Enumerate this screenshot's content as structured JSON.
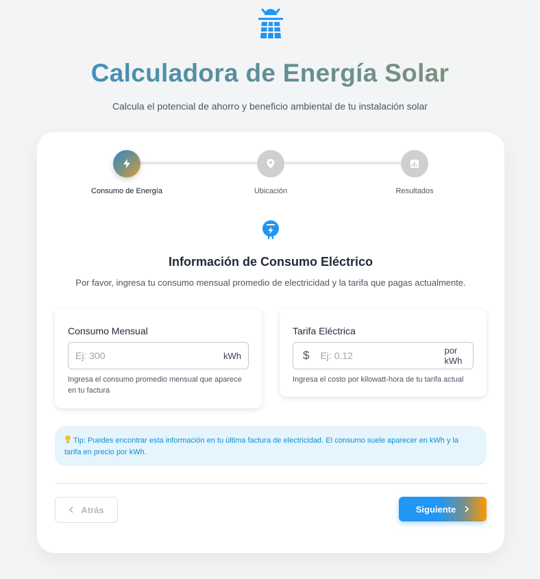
{
  "header": {
    "logo_icon": "solar-panel-icon",
    "title": "Calculadora de Energía Solar",
    "subtitle": "Calcula el potencial de ahorro y beneficio ambiental de tu instalación solar"
  },
  "steps": [
    {
      "label": "Consumo de Energía",
      "icon": "bolt-icon",
      "state": "active"
    },
    {
      "label": "Ubicación",
      "icon": "location-pin-icon",
      "state": "inactive"
    },
    {
      "label": "Resultados",
      "icon": "bar-chart-icon",
      "state": "inactive"
    }
  ],
  "section": {
    "icon": "electric-meter-icon",
    "title": "Información de Consumo Eléctrico",
    "description": "Por favor, ingresa tu consumo mensual promedio de electricidad y la tarifa que pagas actualmente."
  },
  "consumo": {
    "label": "Consumo Mensual",
    "placeholder": "Ej: 300",
    "value": "",
    "unit": "kWh",
    "helper_line1": "Ingresa el consumo promedio mensual que aparece",
    "helper_line2": "en tu factura"
  },
  "tarifa": {
    "label": "Tarifa Eléctrica",
    "prefix": "$",
    "placeholder": "Ej: 0.12",
    "value": "",
    "unit": "por kWh",
    "helper": "Ingresa el costo por kilowatt-hora de tu tarifa actual"
  },
  "tip": {
    "icon": "lightbulb-icon",
    "line1": "Tip: Puedes encontrar esta información en tu última factura de electricidad. El consumo suele aparecer en kWh y la",
    "line2": "tarifa en precio por kWh."
  },
  "nav": {
    "back_label": "Atrás",
    "next_label": "Siguiente"
  },
  "colors": {
    "accent_blue": "#2196f3",
    "accent_orange": "#ff9800",
    "tip_bg": "#e5f4fd",
    "tip_text": "#0f8fd0"
  }
}
